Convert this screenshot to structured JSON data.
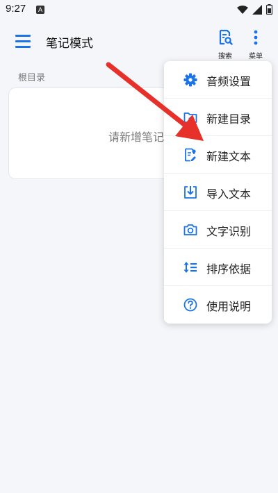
{
  "status_bar": {
    "time": "9:27",
    "notification_badge": "A",
    "icons": [
      "wifi-icon",
      "signal-icon",
      "battery-icon"
    ]
  },
  "app_bar": {
    "title": "笔记模式",
    "menu_icon": "hamburger-menu-icon",
    "search_label": "搜索",
    "more_label": "菜单"
  },
  "main": {
    "section_label": "根目录",
    "empty_text": "请新增笔记"
  },
  "popup_menu": {
    "items": [
      {
        "label": "音频设置",
        "icon": "gear-icon"
      },
      {
        "label": "新建目录",
        "icon": "folder-add-icon"
      },
      {
        "label": "新建文本",
        "icon": "new-document-icon"
      },
      {
        "label": "导入文本",
        "icon": "import-icon"
      },
      {
        "label": "文字识别",
        "icon": "camera-icon"
      },
      {
        "label": "排序依据",
        "icon": "sort-icon"
      },
      {
        "label": "使用说明",
        "icon": "help-circle-icon"
      }
    ]
  },
  "colors": {
    "accent": "#1a73e8",
    "background": "#f5f6fa",
    "annotation_arrow": "#e8302a"
  }
}
